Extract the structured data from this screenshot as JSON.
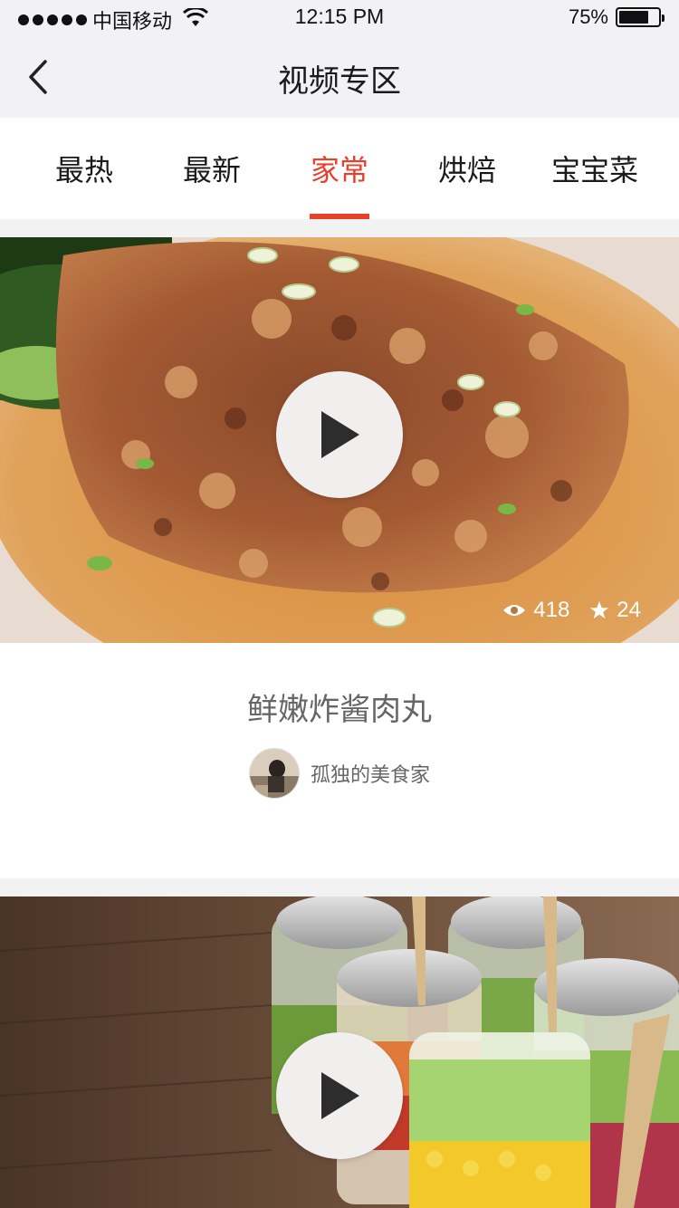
{
  "status_bar": {
    "carrier": "中国移动",
    "time": "12:15 PM",
    "battery": "75%",
    "battery_level": 0.75
  },
  "nav": {
    "title": "视频专区",
    "back_icon": "chevron-left-icon"
  },
  "tabs": [
    {
      "label": "最热",
      "active": false
    },
    {
      "label": "最新",
      "active": false
    },
    {
      "label": "家常",
      "active": true
    },
    {
      "label": "烘焙",
      "active": false
    },
    {
      "label": "宝宝菜",
      "active": false
    }
  ],
  "videos": [
    {
      "views": "418",
      "stars": "24",
      "title": "鲜嫩炸酱肉丸",
      "author": "孤独的美食家"
    },
    {
      "views": "",
      "stars": "",
      "title": "",
      "author": ""
    }
  ],
  "colors": {
    "accent": "#e8402a",
    "background": "#f2f2f2",
    "card": "#ffffff"
  }
}
